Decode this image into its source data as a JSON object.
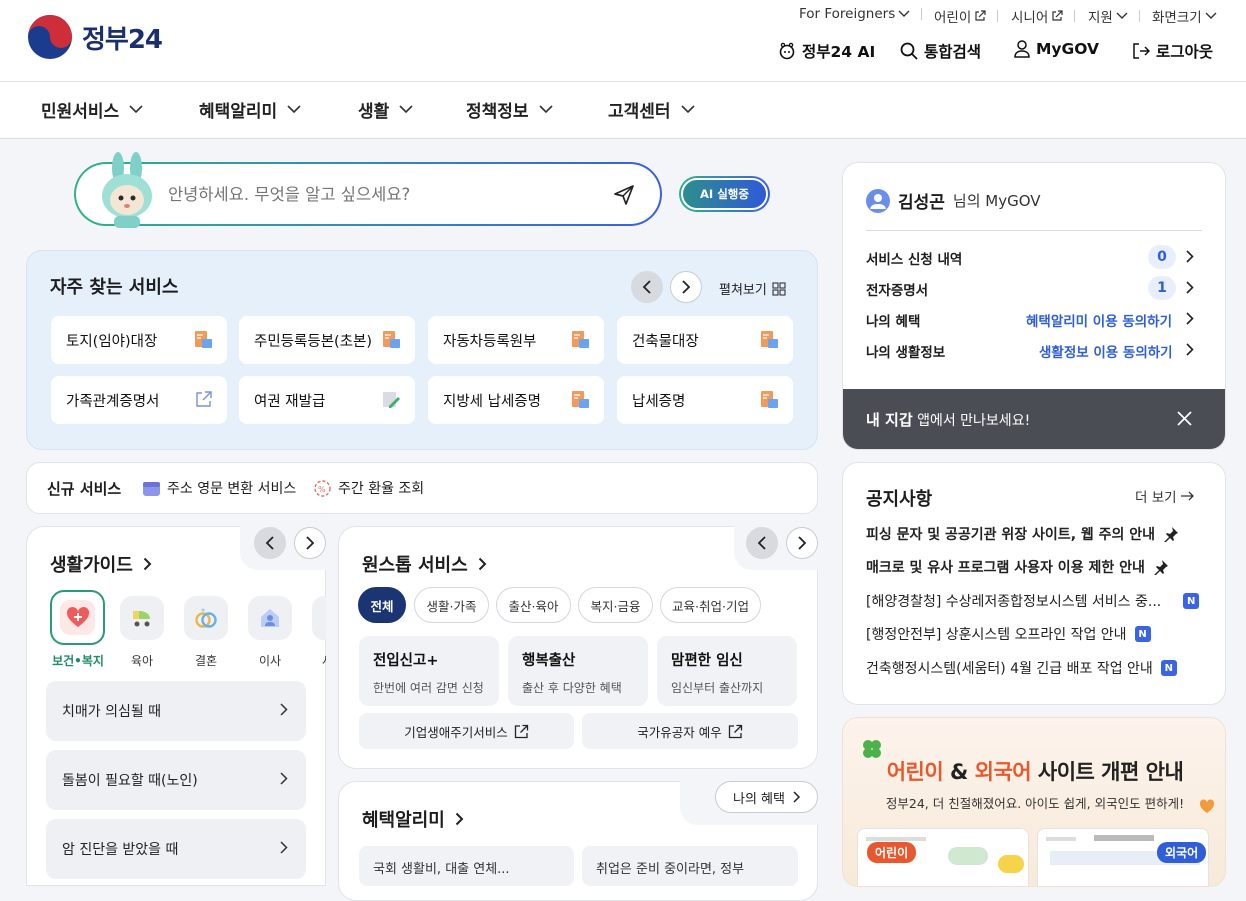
{
  "header": {
    "logo_text": "정부24",
    "top_links": [
      {
        "label": "For Foreigners"
      },
      {
        "label": "어린이"
      },
      {
        "label": "시니어"
      },
      {
        "label": "지원"
      },
      {
        "label": "화면크기"
      }
    ],
    "util": {
      "ai": "정부24 AI",
      "search": "통합검색",
      "mygov": "MyGOV",
      "logout": "로그아웃"
    }
  },
  "nav": {
    "items": [
      "민원서비스",
      "혜택알리미",
      "생활",
      "정책정보",
      "고객센터"
    ]
  },
  "ai_search": {
    "placeholder": "안녕하세요. 무엇을 알고 싶으세요?",
    "badge": "AI 실행중"
  },
  "frequent": {
    "title": "자주 찾는 서비스",
    "expand": "펼쳐보기",
    "items": [
      "토지(임야)대장",
      "주민등록등본(초본)",
      "자동차등록원부",
      "건축물대장",
      "가족관계증명서",
      "여권 재발급",
      "지방세 납세증명",
      "납세증명"
    ]
  },
  "new_services": {
    "title": "신규 서비스",
    "items": [
      "주소 영문 변환 서비스",
      "주간 환율 조회"
    ]
  },
  "life_guide": {
    "title": "생활가이드",
    "categories": [
      "보건•복지",
      "육아",
      "결혼",
      "이사",
      "사"
    ],
    "buttons": [
      "치매가 의심될 때",
      "돌봄이 필요할 때(노인)",
      "암 진단을 받았을 때"
    ]
  },
  "onestop": {
    "title": "원스톱 서비스",
    "tabs": [
      "전체",
      "생활·가족",
      "출산·육아",
      "복지·금융",
      "교육·취업·기업"
    ],
    "cards": [
      {
        "title": "전입신고+",
        "sub": "한번에 여러 감면 신청"
      },
      {
        "title": "행복출산",
        "sub": "출산 후 다양한 혜택"
      },
      {
        "title": "맘편한 임신",
        "sub": "임신부터 출산까지"
      }
    ],
    "links": [
      "기업생애주기서비스",
      "국가유공자 예우"
    ]
  },
  "benefit": {
    "title": "혜택알리미",
    "my_benefit": "나의 혜택",
    "cards": [
      "국회 생활비, 대출 연체...",
      "취업은 준비 중이라면, 정부"
    ]
  },
  "mygov": {
    "name": "김성곤",
    "suffix": "님의 MyGOV",
    "rows": [
      {
        "label": "서비스 신청 내역",
        "value": "0"
      },
      {
        "label": "전자증명서",
        "value": "1"
      },
      {
        "label": "나의 혜택",
        "value": "혜택알리미 이용 동의하기"
      },
      {
        "label": "나의 생활정보",
        "value": "생활정보 이용 동의하기"
      }
    ],
    "wallet_bold": "내 지갑",
    "wallet_text": "앱에서 만나보세요!"
  },
  "notice": {
    "title": "공지사항",
    "more": "더 보기",
    "items": [
      {
        "text": "피싱 문자 및 공공기관 위장 사이트, 웹 주의 안내",
        "pinned": true
      },
      {
        "text": "매크로 및 유사 프로그램 사용자 이용 제한 안내",
        "pinned": true
      },
      {
        "text": "[해양경찰청] 수상레저종합정보시스템 서비스 중...",
        "new": "N"
      },
      {
        "text": "[행정안전부] 상훈시스템 오프라인 작업 안내",
        "new": "N"
      },
      {
        "text": "건축행정시스템(세움터) 4월 긴급 배포 작업 안내",
        "new": "N"
      }
    ]
  },
  "banner": {
    "title_a": "어린이",
    "title_and": " & ",
    "title_b": "외국어",
    "title_rest": " 사이트 개편 안내",
    "subtitle": "정부24, 더 친절해졌어요. 아이도 쉽게, 외국인도 편하게!",
    "tag_a": "어린이",
    "tag_b": "외국어"
  },
  "colors": {
    "primary": "#1b3b8f",
    "accent_blue": "#2f5fd8",
    "wallet_bg": "#4a4d54",
    "frequent_bg": "#e6f0fa",
    "new_badge": "#3b63e6"
  }
}
